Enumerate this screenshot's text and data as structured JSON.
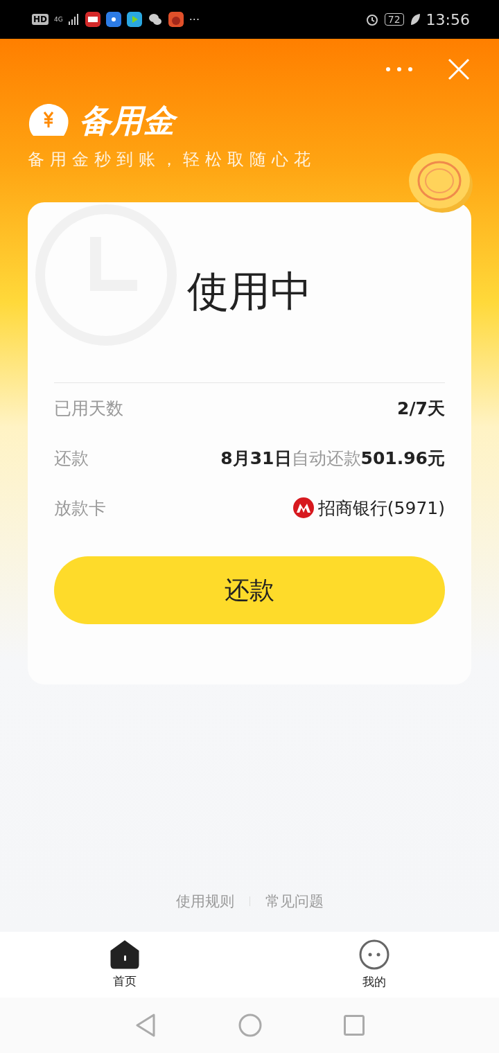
{
  "status_bar": {
    "network": "HD",
    "signal": "4G",
    "more": "···",
    "battery": "72",
    "time": "13:56"
  },
  "header": {
    "title": "备用金",
    "subtitle": "备用金秒到账，轻松取随心花"
  },
  "card": {
    "status": "使用中",
    "rows": [
      {
        "label": "已用天数",
        "value": "**2/7天**",
        "kind": "text"
      },
      {
        "label": "还款",
        "value": "**8月31日**自动还款**501.96元**",
        "kind": "text"
      },
      {
        "label": "放款卡",
        "value": "招商银行(5971)",
        "kind": "bank"
      }
    ],
    "button": "还款"
  },
  "footer_links": [
    "使用规则",
    "常见问题"
  ],
  "tabs": [
    {
      "label": "首页",
      "selected": true
    },
    {
      "label": "我的",
      "selected": false
    }
  ]
}
